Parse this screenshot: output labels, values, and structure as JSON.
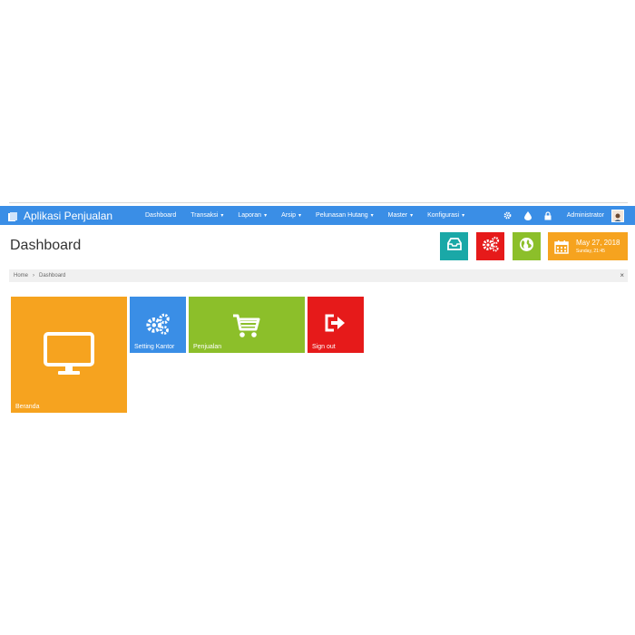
{
  "app": {
    "title": "Aplikasi Penjualan"
  },
  "nav": {
    "items": [
      {
        "label": "Dashboard",
        "dropdown": false
      },
      {
        "label": "Transaksi",
        "dropdown": true
      },
      {
        "label": "Laporan",
        "dropdown": true
      },
      {
        "label": "Arsip",
        "dropdown": true
      },
      {
        "label": "Pelunasan Hutang",
        "dropdown": true
      },
      {
        "label": "Master",
        "dropdown": true
      },
      {
        "label": "Konfigurasi",
        "dropdown": true
      }
    ],
    "caret": "▾",
    "right_icons": [
      "gear-icon",
      "tint-icon",
      "lock-icon"
    ],
    "user": "Administrator"
  },
  "page": {
    "title": "Dashboard"
  },
  "quick_actions": [
    "inbox-icon",
    "gears-icon",
    "globe-icon"
  ],
  "date_widget": {
    "date": "May 27, 2018",
    "time": "Sunday, 21:45",
    "icon": "calendar-icon"
  },
  "breadcrumb": {
    "home": "Home",
    "separator": "›",
    "current": "Dashboard",
    "close": "×"
  },
  "tiles": {
    "beranda": {
      "label": "Beranda",
      "icon": "monitor-icon"
    },
    "setting": {
      "label": "Setting Kantor",
      "icon": "gears-icon"
    },
    "penjualan": {
      "label": "Penjualan",
      "icon": "cart-icon"
    },
    "signout": {
      "label": "Sign out",
      "icon": "sign-out-icon"
    }
  },
  "colors": {
    "navbar": "#3a8ee6",
    "teal": "#1aa8a7",
    "red": "#e61a1a",
    "green": "#8cbf2a",
    "orange": "#f6a31f",
    "breadcrumb_bg": "#f0f0f0"
  }
}
